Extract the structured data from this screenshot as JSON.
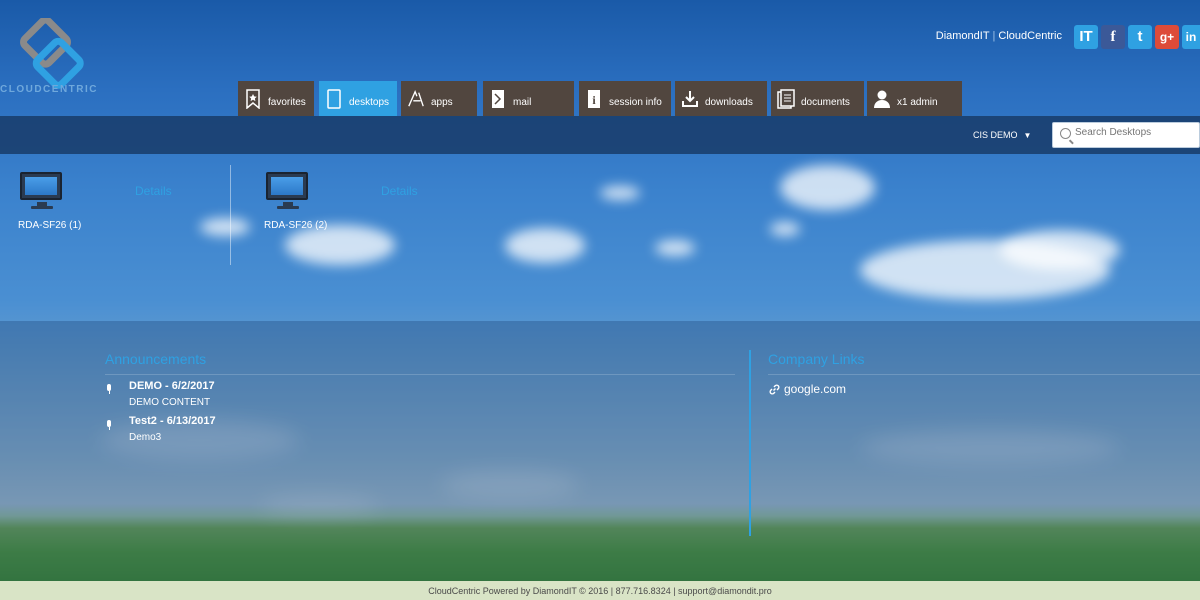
{
  "header": {
    "logo_text": "CLOUDCENTRIC",
    "brand_link_1": "DiamondIT",
    "brand_separator": "|",
    "brand_link_2": "CloudCentric",
    "social": [
      {
        "name": "diamondit",
        "glyph": "IT",
        "color": "#2fa1e2"
      },
      {
        "name": "facebook",
        "glyph": "f",
        "color": "#3b5998"
      },
      {
        "name": "twitter",
        "glyph": "t",
        "color": "#2fa1e2"
      },
      {
        "name": "google-plus",
        "glyph": "g+",
        "color": "#dd4b39"
      },
      {
        "name": "linkedin",
        "glyph": "in",
        "color": "#2fa1e2"
      }
    ]
  },
  "nav": {
    "tabs": [
      {
        "label": "favorites",
        "icon": "bookmark-star-icon",
        "active": false
      },
      {
        "label": "desktops",
        "icon": "desktop-icon",
        "active": true
      },
      {
        "label": "apps",
        "icon": "apps-icon",
        "active": false
      },
      {
        "label": "mail",
        "icon": "mail-icon",
        "active": false
      },
      {
        "label": "session info",
        "icon": "info-icon",
        "active": false
      },
      {
        "label": "downloads",
        "icon": "download-icon",
        "active": false
      },
      {
        "label": "documents",
        "icon": "documents-icon",
        "active": false
      },
      {
        "label": "x1 admin",
        "icon": "user-admin-icon",
        "active": false
      }
    ]
  },
  "toolbar": {
    "account_label": "CIS DEMO",
    "search_placeholder": "Search Desktops"
  },
  "desktops": [
    {
      "name": "RDA-SF26 (1)",
      "details_label": "Details"
    },
    {
      "name": "RDA-SF26 (2)",
      "details_label": "Details"
    }
  ],
  "announcements": {
    "title": "Announcements",
    "items": [
      {
        "title": "DEMO - 6/2/2017",
        "body": "DEMO CONTENT"
      },
      {
        "title": "Test2 - 6/13/2017",
        "body": "Demo3"
      }
    ]
  },
  "company_links": {
    "title": "Company Links",
    "items": [
      {
        "label": "google.com"
      }
    ]
  },
  "footer": {
    "text": "CloudCentric Powered by DiamondIT © 2016 | 877.716.8324 | support@diamondit.pro"
  },
  "colors": {
    "accent": "#2fa1e2",
    "tab_bg": "#51463f",
    "toolbar_bg": "#1a4070",
    "footer_bg": "#d9e4c6"
  }
}
